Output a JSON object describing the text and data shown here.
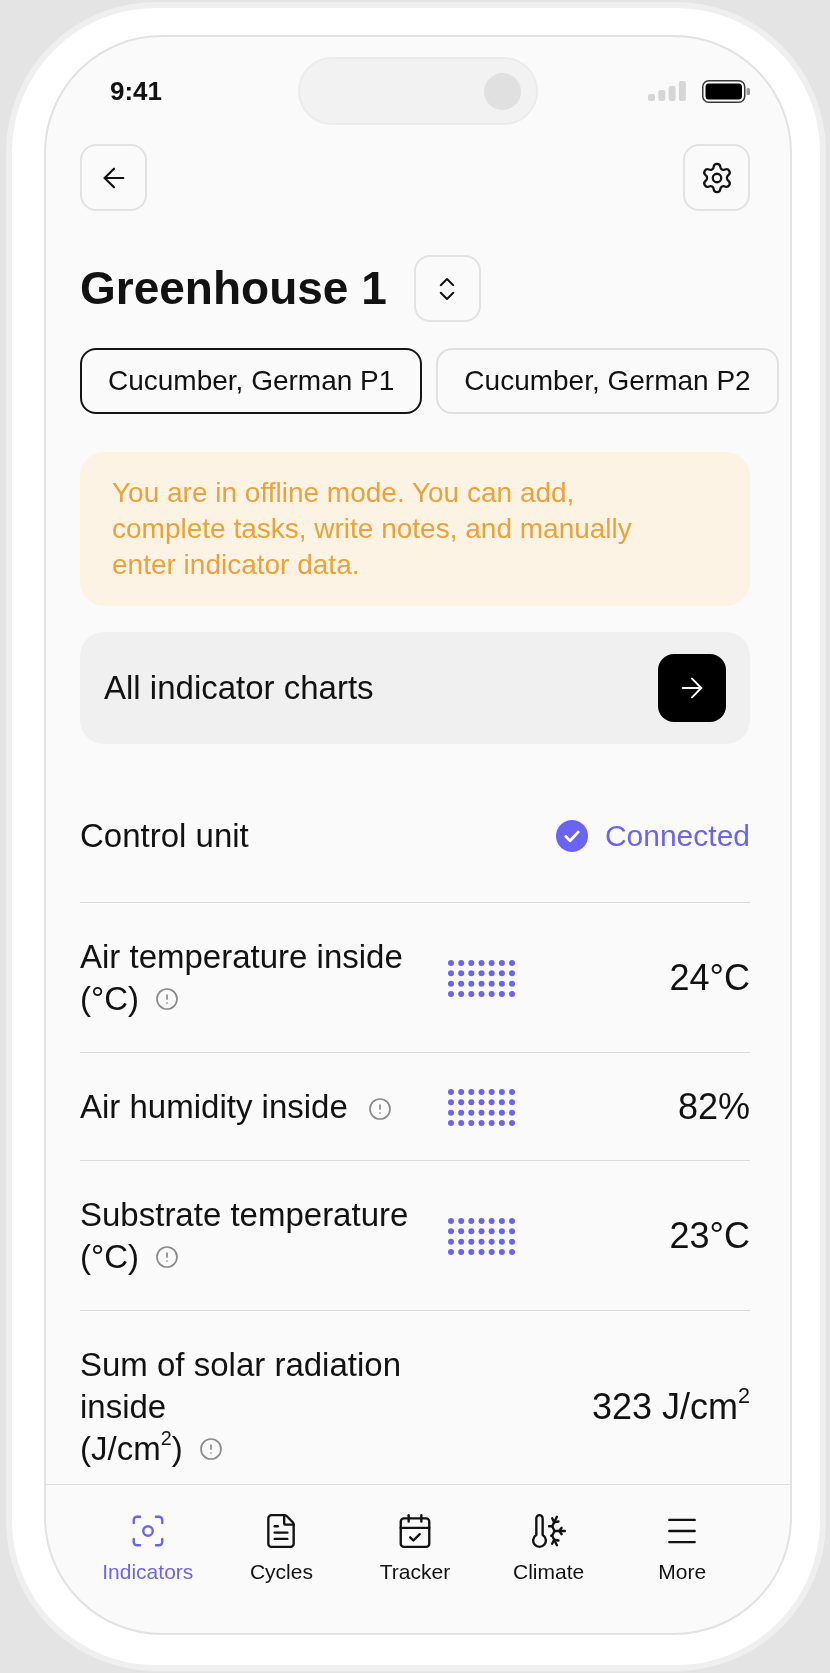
{
  "status_bar": {
    "time": "9:41"
  },
  "header": {
    "title": "Greenhouse 1"
  },
  "crops": [
    {
      "label": "Cucumber, German P1",
      "selected": true
    },
    {
      "label": "Cucumber, German P2",
      "selected": false
    }
  ],
  "offline_notice": {
    "text": "You are in offline mode. You can add, complete tasks, write notes, and manually enter indicator data."
  },
  "charts_link": {
    "label": "All indicator charts"
  },
  "control_unit": {
    "label": "Control unit",
    "status": "Connected",
    "connected": true
  },
  "indicators": [
    {
      "label": "Air temperature inside",
      "unit": "(°C)",
      "value": "24°C",
      "chart": true
    },
    {
      "label": "Air humidity inside",
      "value": "82%",
      "chart": true
    },
    {
      "label": "Substrate temperature",
      "unit": "(°C)",
      "value": "23°C",
      "chart": true
    },
    {
      "label": "Sum of solar radiation inside",
      "unit": "(J/cm$^{2}$)",
      "value": "323 J/cm$^{2}$",
      "chart": false
    }
  ],
  "nav": [
    {
      "label": "Indicators",
      "selected": true
    },
    {
      "label": "Cycles",
      "selected": false
    },
    {
      "label": "Tracker",
      "selected": false
    },
    {
      "label": "Climate",
      "selected": false
    },
    {
      "label": "More",
      "selected": false
    }
  ]
}
